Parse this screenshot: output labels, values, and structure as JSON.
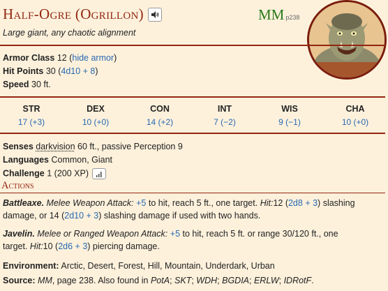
{
  "name": "Half-Ogre (Ogrillon)",
  "source": {
    "book": "MM",
    "page": "p238"
  },
  "subtitle": "Large giant, any chaotic alignment",
  "armor_class": {
    "label": "Armor Class",
    "value": "12",
    "detail": "hide armor"
  },
  "hit_points": {
    "label": "Hit Points",
    "value": "30",
    "formula": "4d10 + 8"
  },
  "speed": {
    "label": "Speed",
    "value": "30 ft."
  },
  "abilities": [
    {
      "name": "STR",
      "value": "17 (+3)"
    },
    {
      "name": "DEX",
      "value": "10 (+0)"
    },
    {
      "name": "CON",
      "value": "14 (+2)"
    },
    {
      "name": "INT",
      "value": "7 (−2)"
    },
    {
      "name": "WIS",
      "value": "9 (−1)"
    },
    {
      "name": "CHA",
      "value": "10 (+0)"
    }
  ],
  "senses": {
    "label": "Senses",
    "link": "darkvision",
    "rest": "60 ft., passive Perception 9"
  },
  "languages": {
    "label": "Languages",
    "value": "Common, Giant"
  },
  "challenge": {
    "label": "Challenge",
    "value": "1 (200 XP)"
  },
  "actions_header": "Actions",
  "actions": [
    {
      "name": "Battleaxe.",
      "type": "Melee Weapon Attack:",
      "bonus": "+5",
      "reach": "to hit, reach 5 ft., one target.",
      "hit_label": "Hit:",
      "hit_value": "12",
      "dice": "2d8 + 3",
      "after_dice": "slashing",
      "line2_pre": "damage, or 14 (",
      "dice2": "2d10 + 3",
      "line2_post": ") slashing damage if used with two hands."
    },
    {
      "name": "Javelin.",
      "type": "Melee or Ranged Weapon Attack:",
      "bonus": "+5",
      "reach": "to hit, reach 5 ft. or range 30/120 ft., one",
      "line2_pre": "target.",
      "hit_label": "Hit:",
      "hit_value": "10",
      "dice": "2d6 + 3",
      "after_dice": "piercing damage."
    }
  ],
  "environment": {
    "label": "Environment:",
    "value": "Arctic, Desert, Forest, Hill, Mountain, Underdark, Urban"
  },
  "source_line": {
    "label": "Source:",
    "book": "MM",
    "page_text": ", page 238. Also found in",
    "also": [
      "PotA",
      "SKT",
      "WDH",
      "BGDIA",
      "ERLW",
      "IDRotF"
    ]
  },
  "icons": {
    "speaker": "speaker-icon",
    "xp": "bar-chart-icon"
  },
  "colors": {
    "title": "#922610",
    "link": "#2869b0",
    "source_badge": "#2a7a1a",
    "background": "#fdf1dc"
  }
}
